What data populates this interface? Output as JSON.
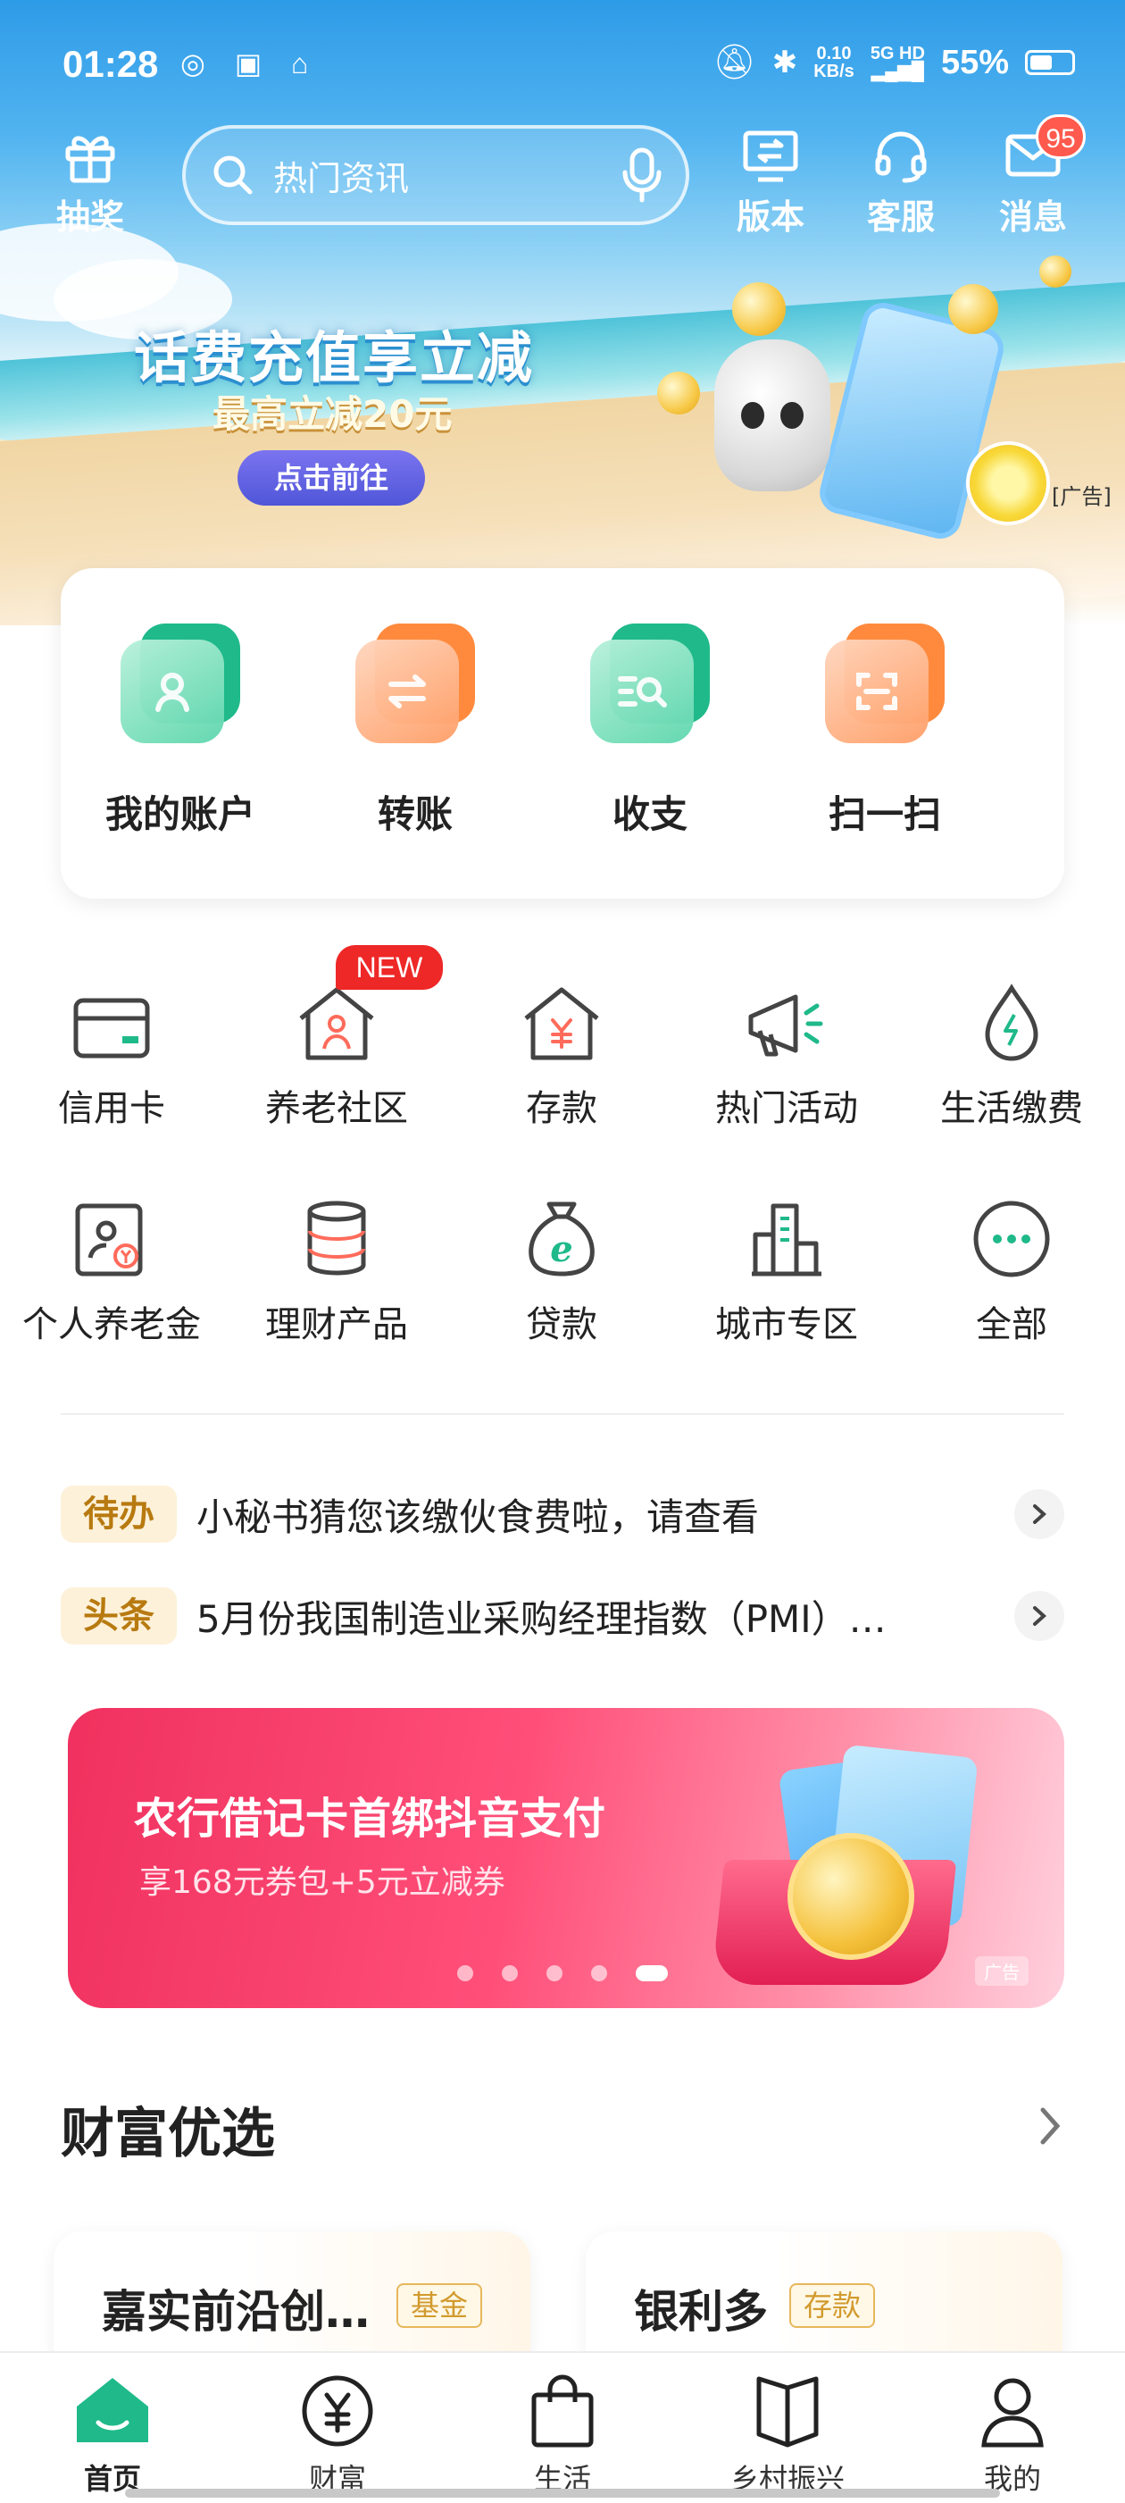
{
  "status_bar": {
    "time": "01:28",
    "speed_value": "0.10",
    "speed_unit": "KB/s",
    "network": "5G HD",
    "battery": "55%",
    "battery_level": 0.55
  },
  "topbar": {
    "lottery_label": "抽奖",
    "search_placeholder": "热门资讯",
    "version_label": "版本",
    "service_label": "客服",
    "message_label": "消息",
    "message_badge": "95"
  },
  "banner": {
    "title": "话费充值享立减",
    "subtitle": "最高立减20元",
    "button": "点击前往",
    "ad_tag": "[广告]"
  },
  "quick_actions": [
    {
      "label": "我的账户",
      "icon": "account-icon",
      "color": "green"
    },
    {
      "label": "转账",
      "icon": "transfer-icon",
      "color": "orange"
    },
    {
      "label": "收支",
      "icon": "income-expense-icon",
      "color": "green"
    },
    {
      "label": "扫一扫",
      "icon": "scan-icon",
      "color": "orange"
    }
  ],
  "services": [
    {
      "label": "信用卡",
      "icon": "credit-card-icon"
    },
    {
      "label": "养老社区",
      "icon": "elderly-community-icon",
      "badge": "NEW"
    },
    {
      "label": "存款",
      "icon": "deposit-icon"
    },
    {
      "label": "热门活动",
      "icon": "megaphone-icon"
    },
    {
      "label": "生活缴费",
      "icon": "utility-payment-icon"
    },
    {
      "label": "个人养老金",
      "icon": "pension-icon"
    },
    {
      "label": "理财产品",
      "icon": "wealth-product-icon"
    },
    {
      "label": "贷款",
      "icon": "loan-icon"
    },
    {
      "label": "城市专区",
      "icon": "city-icon"
    },
    {
      "label": "全部",
      "icon": "more-icon"
    }
  ],
  "notices": [
    {
      "tag": "待办",
      "text": "小秘书猜您该缴伙食费啦，请查看"
    },
    {
      "tag": "头条",
      "text": "5月份我国制造业采购经理指数（PMI）…"
    }
  ],
  "promo": {
    "title": "农行借记卡首绑抖音支付",
    "subtitle": "享168元券包+5元立减券",
    "ad_tag": "广告",
    "slide_count": 5,
    "active_slide": 5
  },
  "wealth": {
    "title": "财富优选",
    "cards": [
      {
        "name": "嘉实前沿创…",
        "tag": "基金"
      },
      {
        "name": "银利多",
        "tag": "存款"
      }
    ]
  },
  "bottom_nav": [
    {
      "label": "首页",
      "icon": "home-icon",
      "active": true
    },
    {
      "label": "财富",
      "icon": "yuan-icon",
      "active": false
    },
    {
      "label": "生活",
      "icon": "shopping-bag-icon",
      "active": false
    },
    {
      "label": "乡村振兴",
      "icon": "book-icon",
      "active": false
    },
    {
      "label": "我的",
      "icon": "person-icon",
      "active": false
    }
  ],
  "colors": {
    "brand_green": "#1fb98a",
    "accent_orange": "#ff8a3d",
    "badge_red": "#ff5a4d",
    "promo_pink": "#f0315f"
  }
}
